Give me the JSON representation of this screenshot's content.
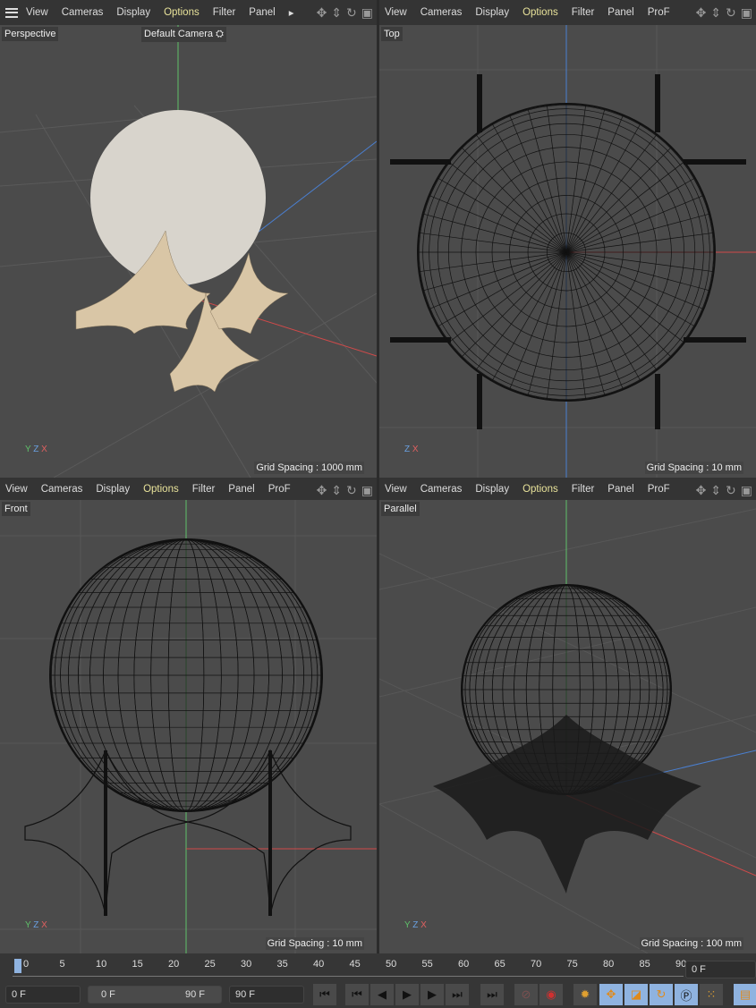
{
  "menu": [
    "View",
    "Cameras",
    "Display",
    "Options",
    "Filter",
    "Panel",
    "ProF"
  ],
  "highlight_color": "#e8e29a",
  "viewports": [
    {
      "name": "Perspective",
      "camera": "Default Camera",
      "grid": "Grid Spacing : 1000 mm",
      "axes": [
        "Y",
        "Z",
        "X"
      ]
    },
    {
      "name": "Top",
      "grid": "Grid Spacing : 10 mm",
      "axes": [
        "Z",
        "X"
      ]
    },
    {
      "name": "Front",
      "grid": "Grid Spacing : 10 mm",
      "axes": [
        "Y",
        "Z",
        "X"
      ]
    },
    {
      "name": "Parallel",
      "grid": "Grid Spacing : 100 mm",
      "axes": [
        "Y",
        "Z",
        "X"
      ]
    }
  ],
  "nav_icons": [
    "move-view-icon",
    "zoom-view-icon",
    "rotate-view-icon",
    "maximize-view-icon"
  ],
  "timeline": {
    "ticks": [
      "0",
      "5",
      "10",
      "15",
      "20",
      "25",
      "30",
      "35",
      "40",
      "45",
      "50",
      "55",
      "60",
      "65",
      "70",
      "75",
      "80",
      "85",
      "90"
    ],
    "current_frame": "0 F",
    "start": "0 F",
    "range_start": "0 F",
    "range_end": "90 F",
    "end": "90 F"
  }
}
